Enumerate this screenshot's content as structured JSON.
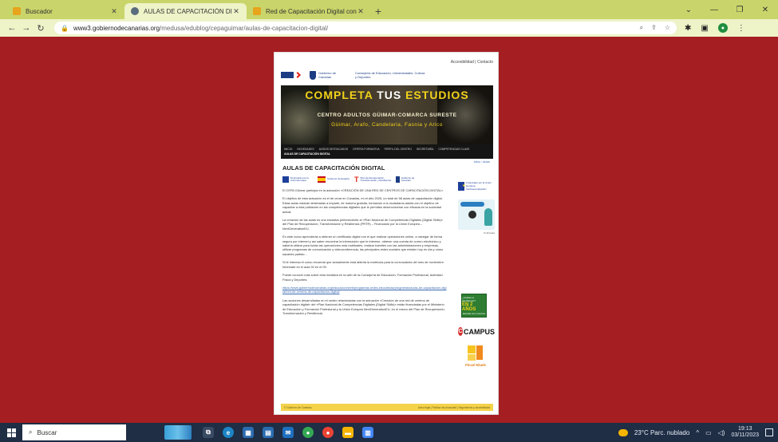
{
  "browser": {
    "tabs": [
      {
        "label": "Buscador",
        "color": "#e7a41c"
      },
      {
        "label": "AULAS DE CAPACITACIÓN DIGIT",
        "color": "#5a6d7e"
      },
      {
        "label": "Red de Capacitación Digital con",
        "color": "#e7a41c"
      }
    ],
    "url_host": "www3.gobiernodecanarias.org",
    "url_path": "/medusa/edublog/cepaguimar/aulas-de-capacitacion-digital/"
  },
  "page": {
    "accessibility_link": "Accesibilidad | Contacto",
    "government_name": "Gobierno de Canarias",
    "ministry_name": "Consejería de Educación, Universidades, Cultura y Deportes",
    "banner": {
      "title_a": "COMPLETA",
      "title_b": "TUS",
      "title_c": "ESTUDIOS",
      "subtitle": "CENTRO ADULTOS GÜIMAR-COMARCA SURESTE",
      "places": "Güimar, Arafo, Candelaria, Fasnia y Arico"
    },
    "menu": [
      "INICIO",
      "NOVEDADES",
      "AVISOS DESTACADOS",
      "OFERTA FORMATIVA",
      "PERFIL DEL CENTRO",
      "SECRETARÍA",
      "COMPETENCIAS CLAVE",
      "AULAS DE CAPACITACIÓN DIGITAL"
    ],
    "breadcrumb": "Inicio › Aulas",
    "title": "AULAS DE CAPACITACIÓN DIGITAL",
    "funders": {
      "eu": "Financiado por la Unión Europea",
      "spain": "Gobierno de España",
      "prtr": "Plan de Recuperación, Transformación y Resiliencia",
      "canarias": "Gobierno de Canarias"
    },
    "paragraphs": [
      "El CEPA Güímar participa en la actuación «CREACIÓN DE UNA RED DE CENTROS DE CAPACITACIÓN DIGITAL».",
      "El objetivo de esta actuación es el de crear en Canarias, en el año 2025, un total de 58 aulas de capacitación digital. Estas aulas estarán destinadas a impartir, de manera gratuita, formación a la ciudadanía adulta con el objetivo de capacitar a esta población en las competencias digitales que le permitan desenvolverse con eficacia en la sociedad actual.",
      "La creación de las aulas es una iniciativa perteneciente al «Plan Nacional de Competencias Digitales (Digital Skills)» del Plan de Recuperación, Transformación y Resiliencia (PRTR) – Financiado por la Unión Europea – NextGenerationEU.",
      "En este curso aprenderás a obtener un certificado digital con el que realizar operaciones online, a navegar de forma segura por internet y así saber encontrar la información que te interese, obtener una cuenta de correo electrónico y saberla utilizar para todas las operaciones más habituales, realizar trámites con las administraciones y empresas, utilizar programas de comunicación y videoconferencia, las principales redes sociales que existen hoy en día y cómo sacarles partido...",
      "Si te interesa el curso recuerda que actualmente está abierta la matrícula para la convocatoria del mes de noviembre. Infórmate en el aula 92 en el 09.",
      "Puede conocer más sobre esta iniciativa en la web de la Consejería de Educación, Formación Profesional, Actividad Física y Deportes:",
      "https://www.gobiernodecanarias.org/educacion/web/programas-redes-educativas/programas/aulas-de-capacitacion-digital/red-de-centros-de-capacitacion-digital/",
      "Las acciones desarrolladas en el centro relacionadas con la actuación «Creación de una red de centros de capacitación digital» del «Plan Nacional de Competencias Digitales (Digital Skills)» están financiadas por el Ministerio de Educación y Formación Profesional y la Unión Europea NextGenerationEU, en el marco del Plan de Recuperación, Transformación y Resiliencia."
    ],
    "sidebar": {
      "eu_label": "Financiado por la Unión Europea NextGenerationEU",
      "ad_caption": "Publicidad",
      "green_top": "¿Acabas el bachillerato?",
      "green_main": "EN 2 AÑOS",
      "green_bottom": "Estudia con nosotros",
      "campus": "CAMPUS",
      "pincel": "Pincel Ekade"
    },
    "footer_left": "© Gobierno de Canarias",
    "footer_right": "Aviso legal | Política de privacidad | Seguimiento y accesibilidad"
  },
  "taskbar": {
    "search_placeholder": "Buscar",
    "weather": "23°C  Parc. nublado",
    "time": "19:13",
    "date": "03/11/2023",
    "apps": [
      {
        "name": "task-view",
        "color": "#3a4a63"
      },
      {
        "name": "edge",
        "color": "#1c84c6"
      },
      {
        "name": "store",
        "color": "#2b6cb0"
      },
      {
        "name": "calendar",
        "color": "#2b6cb0"
      },
      {
        "name": "mail",
        "color": "#1f6fbf"
      },
      {
        "name": "chrome",
        "color": "#34a853"
      },
      {
        "name": "chrome-alt",
        "color": "#ea4335"
      },
      {
        "name": "explorer",
        "color": "#f4b400"
      },
      {
        "name": "docs",
        "color": "#4285f4"
      }
    ]
  }
}
